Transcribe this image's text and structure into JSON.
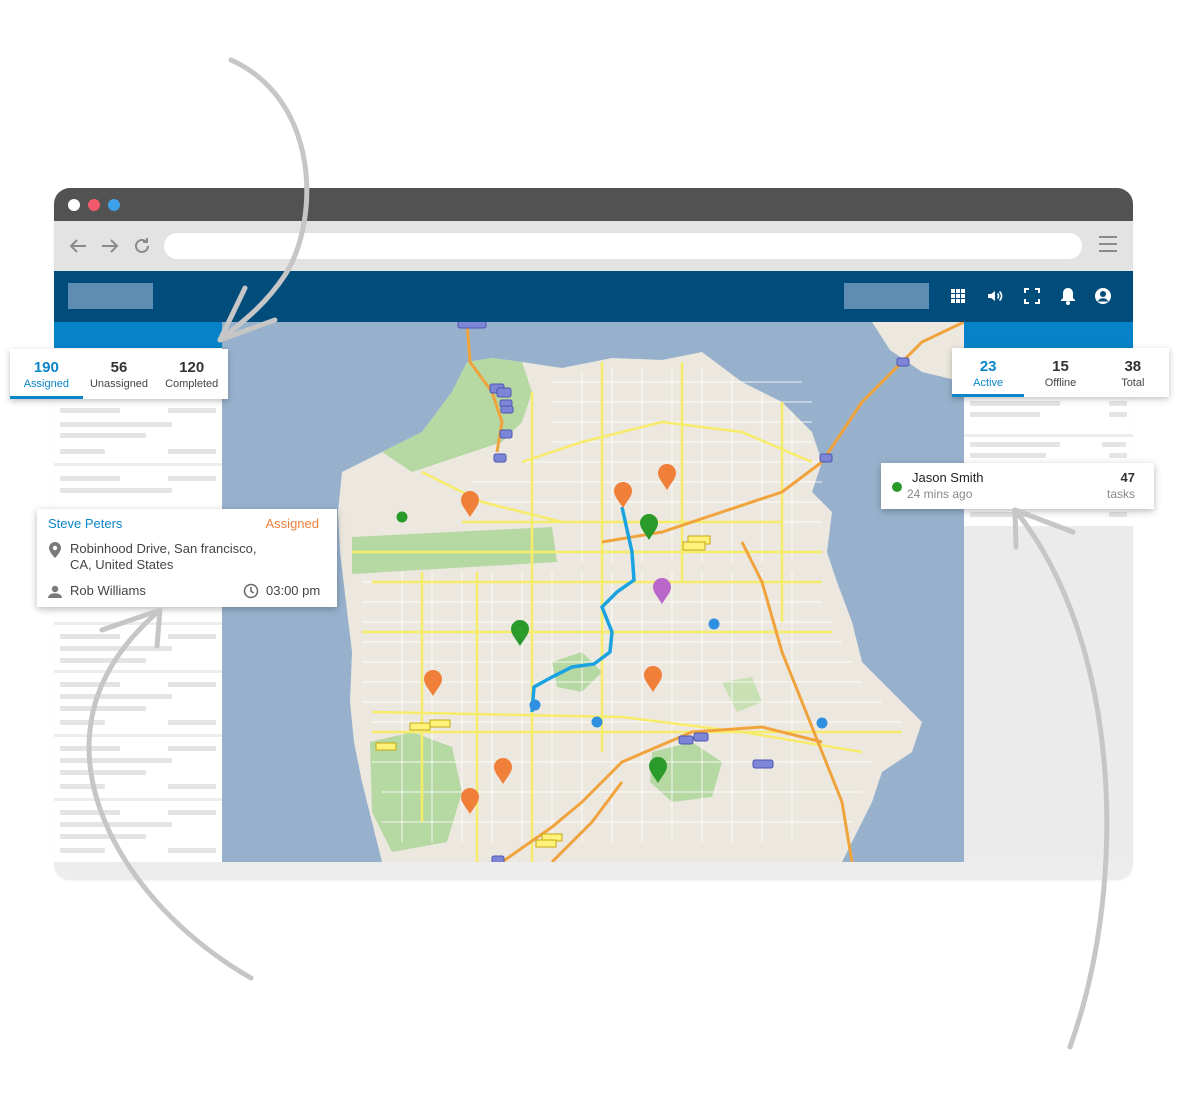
{
  "colors": {
    "window_chrome": "#525252",
    "app_header": "#004d7c",
    "accent": "#0a86c9",
    "assigned_orange": "#f07f3a",
    "success_green": "#2a9a2a",
    "water": "#97b1cd",
    "land": "#ece8df",
    "park": "#b6d8a3",
    "road": "#f7ec6a",
    "route": "#1aa3e0",
    "pin_purple": "#b967c9",
    "arrow_gray": "#c6c6c6"
  },
  "browser": {
    "window_dots": [
      "#ffffff",
      "#f25b6b",
      "#3ea0e8"
    ],
    "nav_icons": [
      "back-arrow-icon",
      "forward-arrow-icon",
      "reload-icon"
    ],
    "menu_icon": "hamburger-menu-icon"
  },
  "app_header": {
    "icons": [
      "apps-grid-icon",
      "volume-icon",
      "fullscreen-icon",
      "notification-bell-icon",
      "account-circle-icon"
    ]
  },
  "task_stats": [
    {
      "count": "190",
      "label": "Assigned",
      "active": true
    },
    {
      "count": "56",
      "label": "Unassigned",
      "active": false
    },
    {
      "count": "120",
      "label": "Completed",
      "active": false
    }
  ],
  "agent_stats": [
    {
      "count": "23",
      "label": "Active",
      "active": true
    },
    {
      "count": "15",
      "label": "Offline",
      "active": false
    },
    {
      "count": "38",
      "label": "Total",
      "active": false
    }
  ],
  "task_card": {
    "name": "Steve Peters",
    "status": "Assigned",
    "address_line1": "Robinhood Drive, San francisco,",
    "address_line2": "CA, United States",
    "agent": "Rob Williams",
    "time": "03:00 pm"
  },
  "agent_card": {
    "name": "Jason Smith",
    "last_seen": "24 mins ago",
    "task_count": "47",
    "task_label": "tasks",
    "status_color": "#2a9a2a"
  },
  "map": {
    "markers": [
      {
        "kind": "task-pin",
        "color": "#f07f3a"
      },
      {
        "kind": "task-pin",
        "color": "#2a9a2a"
      },
      {
        "kind": "task-pin",
        "color": "#b967c9"
      },
      {
        "kind": "agent-dot",
        "color": "#2f90e0"
      },
      {
        "kind": "agent-dot",
        "color": "#2a9a2a"
      }
    ]
  }
}
